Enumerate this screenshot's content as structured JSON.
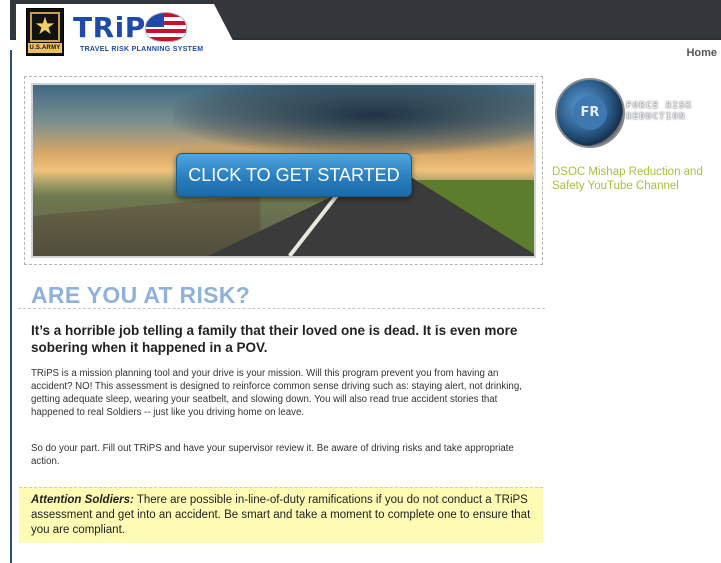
{
  "header": {
    "logo_text": "TRiPS",
    "logo_subtitle": "TRAVEL RISK PLANNING SYSTEM",
    "army_label": "U.S.ARMY",
    "nav_home": "Home"
  },
  "hero": {
    "cta_label": "CLICK TO GET STARTED"
  },
  "main": {
    "headline": "ARE YOU AT RISK?",
    "lead": "It’s a horrible job telling a family that their loved one is dead. It is even more sobering when it happened in a POV.",
    "paragraph1": "TRiPS is a mission planning tool and your drive is your mission. Will this program prevent you from having an accident? NO! This assessment is designed to reinforce common sense driving such as: staying alert, not drinking, getting adequate sleep, wearing your seatbelt, and slowing down. You will also read true accident stories that happened to real Soldiers -- just like you driving home on leave.",
    "paragraph2": "So do your part. Fill out TRiPS and have your supervisor review it. Be aware of driving risks and take appropriate action.",
    "attention_label": "Attention Soldiers:",
    "attention_text": " There are possible in-line-of-duty ramifications if you do not conduct a TRiPS assessment and get into an accident. Be smart and take a moment to complete one to ensure that you are compliant."
  },
  "sidebar": {
    "badge_text": "FR",
    "frr_title": "FORCE RISK REDUCTION",
    "youtube_link": "DSOC Mishap Reduction and Safety YouTube Channel"
  },
  "colors": {
    "headline": "#8fb2dc",
    "cta": "#2a7fbf",
    "attention_bg": "#fefcb4",
    "link_green": "#a7c13d",
    "topbar": "#33373b"
  }
}
